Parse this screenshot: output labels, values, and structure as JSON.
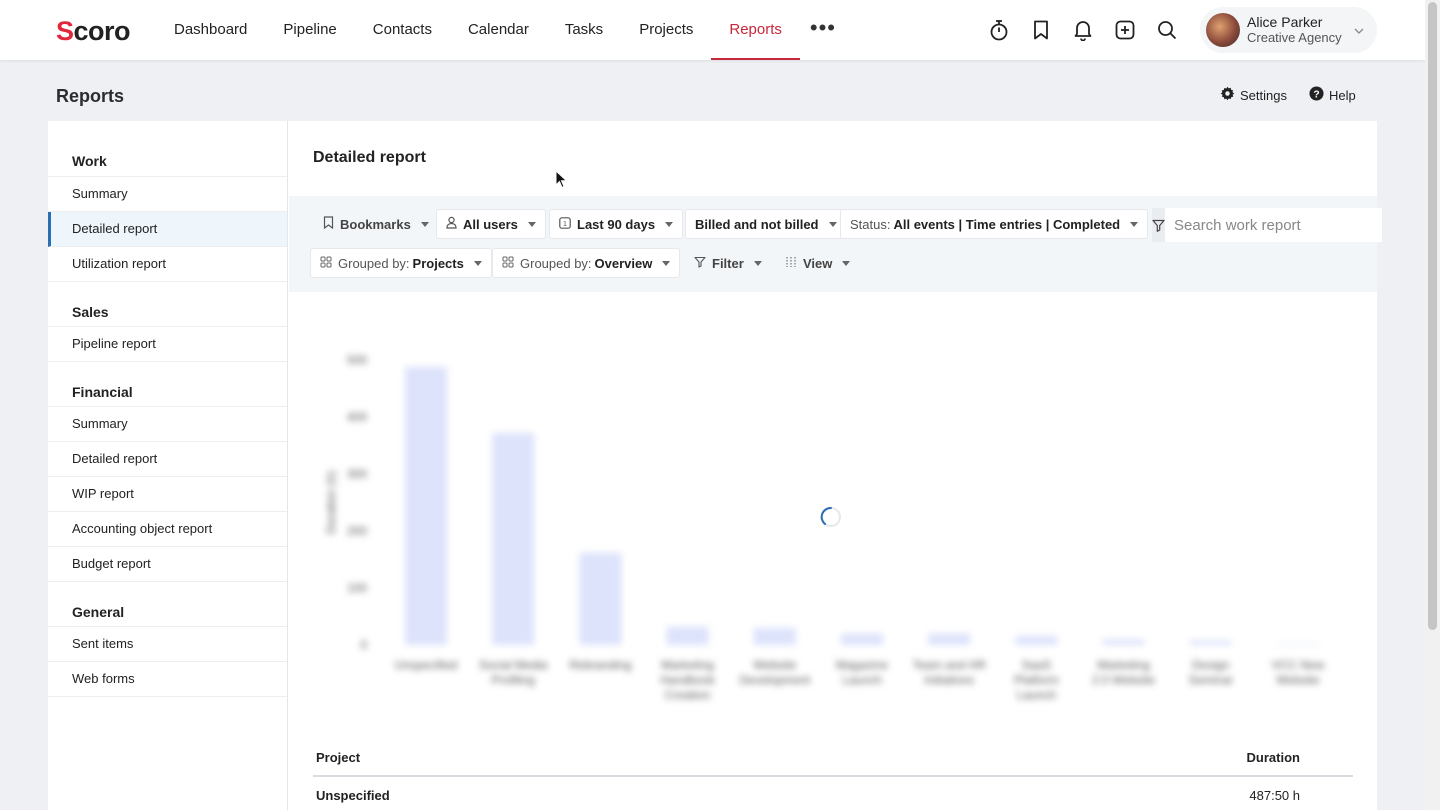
{
  "app": {
    "logo_text": "Scoro"
  },
  "nav": {
    "items": [
      {
        "label": "Dashboard",
        "active": false
      },
      {
        "label": "Pipeline",
        "active": false
      },
      {
        "label": "Contacts",
        "active": false
      },
      {
        "label": "Calendar",
        "active": false
      },
      {
        "label": "Tasks",
        "active": false
      },
      {
        "label": "Projects",
        "active": false
      },
      {
        "label": "Reports",
        "active": true
      }
    ],
    "more_label": "•••"
  },
  "toolbar_icons": [
    "timer-icon",
    "bookmark-icon",
    "bell-icon",
    "add-icon",
    "search-icon"
  ],
  "user": {
    "name": "Alice Parker",
    "org": "Creative Agency"
  },
  "page": {
    "title": "Reports",
    "settings_label": "Settings",
    "help_label": "Help"
  },
  "sidebar": {
    "work": {
      "title": "Work",
      "items": [
        "Summary",
        "Detailed report",
        "Utilization report"
      ],
      "active_index": 1
    },
    "sales": {
      "title": "Sales",
      "items": [
        "Pipeline report"
      ]
    },
    "financial": {
      "title": "Financial",
      "items": [
        "Summary",
        "Detailed report",
        "WIP report",
        "Accounting object report",
        "Budget report"
      ]
    },
    "general": {
      "title": "General",
      "items": [
        "Sent items",
        "Web forms"
      ]
    }
  },
  "report": {
    "title": "Detailed report",
    "filters": {
      "bookmarks": "Bookmarks",
      "users": "All users",
      "period": "Last 90 days",
      "billing": "Billed and not billed",
      "status_prefix": "Status:",
      "status_value": "All events | Time entries | Completed",
      "group1_prefix": "Grouped by:",
      "group1_value": "Projects",
      "group2_prefix": "Grouped by:",
      "group2_value": "Overview",
      "filter": "Filter",
      "view": "View"
    },
    "search": {
      "placeholder": "Search work report"
    }
  },
  "chart_data": {
    "type": "bar",
    "categories": [
      "Unspecified",
      "Social Media Profiling",
      "Rebranding",
      "Marketing Handbook Creation",
      "Website Development",
      "Magazine Launch",
      "Team and HR Initiatives",
      "SaaS Platform Launch",
      "Marketing 2.0 Website",
      "Design Seminar",
      "VCC New Website"
    ],
    "values": [
      488,
      372,
      162,
      32,
      30,
      20,
      20,
      16,
      10,
      8,
      2
    ],
    "ylabel": "Duration (h)",
    "yticks": [
      0,
      100,
      200,
      300,
      400,
      500
    ],
    "ylim": [
      0,
      500
    ],
    "bar_color": "#dde3fb"
  },
  "table": {
    "headers": {
      "project": "Project",
      "duration": "Duration"
    },
    "rows": [
      {
        "project": "Unspecified",
        "duration": "487:50 h"
      }
    ]
  }
}
